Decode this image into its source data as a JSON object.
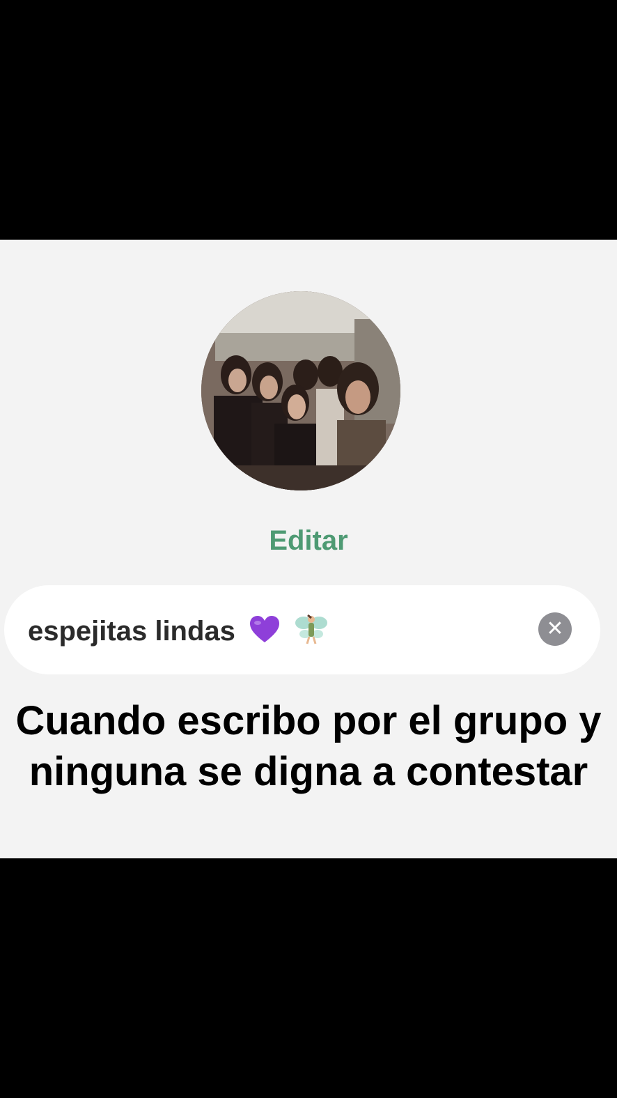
{
  "profile": {
    "photo_description": "group-selfie",
    "edit_label": "Editar"
  },
  "group_name_field": {
    "value": "espejitas lindas",
    "emojis": [
      "purple-heart-emoji",
      "fairy-emoji"
    ],
    "clear_icon": "clear-x-icon"
  },
  "caption": {
    "text": "Cuando escribo por el grupo y ninguna se digna a contestar"
  },
  "colors": {
    "accent_green": "#4e9a73",
    "panel_bg": "#f3f3f3",
    "field_bg": "#ffffff",
    "clear_button": "#8e8e93",
    "heart": "#8e3fd9"
  }
}
